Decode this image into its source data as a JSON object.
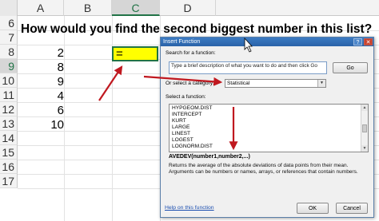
{
  "sheet": {
    "columns": [
      "A",
      "B",
      "C",
      "D"
    ],
    "rows": [
      "6",
      "7",
      "8",
      "9",
      "10",
      "11",
      "12",
      "13",
      "14",
      "15",
      "16",
      "17"
    ],
    "question": "How would you find the second biggest number in this list?",
    "values": [
      "2",
      "8",
      "9",
      "4",
      "6",
      "10"
    ],
    "active_cell_value": "=",
    "active_cell_fill": "#ffff00",
    "accent": "#217346"
  },
  "dialog": {
    "title": "Insert Function",
    "help_glyph": "?",
    "close_glyph": "✕",
    "search_label": "Search for a function:",
    "search_value": "Type a brief description of what you want to do and then click Go",
    "go_label": "Go",
    "category_label": "Or select a category:",
    "category_value": "Statistical",
    "select_label": "Select a function:",
    "functions": [
      "HYPGEOM.DIST",
      "INTERCEPT",
      "KURT",
      "LARGE",
      "LINEST",
      "LOGEST",
      "LOGNORM.DIST"
    ],
    "signature": "AVEDEV(number1,number2,...)",
    "description": "Returns the average of the absolute deviations of data points from their mean. Arguments can be numbers or names, arrays, or references that contain numbers.",
    "help_link": "Help on this function",
    "ok_label": "OK",
    "cancel_label": "Cancel"
  },
  "annotation_color": "#c0181f"
}
